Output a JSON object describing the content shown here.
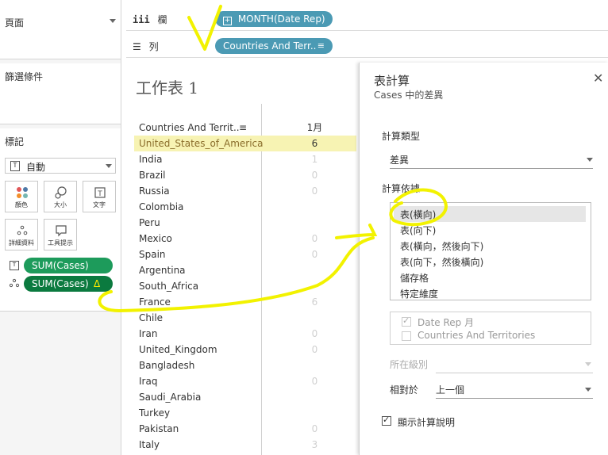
{
  "left_panel": {
    "pages_title": "頁面",
    "filters_title": "篩選條件",
    "marks_title": "標記",
    "mark_type": "自動",
    "mark_buttons": [
      {
        "label": "顏色",
        "icon": "color-dots-icon"
      },
      {
        "label": "大小",
        "icon": "size-icon"
      },
      {
        "label": "文字",
        "icon": "text-icon"
      },
      {
        "label": "詳細資料",
        "icon": "detail-dots-icon"
      },
      {
        "label": "工具提示",
        "icon": "tooltip-icon"
      }
    ],
    "mark_pills": [
      "SUM(Cases)",
      "SUM(Cases)"
    ],
    "delta_symbol": "Δ"
  },
  "shelves": {
    "columns_label": "欄",
    "rows_label": "列",
    "columns_pill": "MONTH(Date Rep)",
    "rows_pill": "Countries And Terr..",
    "plus_symbol": "+"
  },
  "worksheet": {
    "title": "工作表 1",
    "header_country": "Countries And Territ..",
    "header_month": "1月",
    "rows": [
      {
        "name": "United_States_of_America",
        "value": "6"
      },
      {
        "name": "India",
        "value": "1"
      },
      {
        "name": "Brazil",
        "value": "0"
      },
      {
        "name": "Russia",
        "value": "0"
      },
      {
        "name": "Colombia",
        "value": ""
      },
      {
        "name": "Peru",
        "value": ""
      },
      {
        "name": "Mexico",
        "value": "0"
      },
      {
        "name": "Spain",
        "value": "0"
      },
      {
        "name": "Argentina",
        "value": ""
      },
      {
        "name": "South_Africa",
        "value": ""
      },
      {
        "name": "France",
        "value": "6"
      },
      {
        "name": "Chile",
        "value": ""
      },
      {
        "name": "Iran",
        "value": "0"
      },
      {
        "name": "United_Kingdom",
        "value": "0"
      },
      {
        "name": "Bangladesh",
        "value": ""
      },
      {
        "name": "Iraq",
        "value": "0"
      },
      {
        "name": "Saudi_Arabia",
        "value": ""
      },
      {
        "name": "Turkey",
        "value": ""
      },
      {
        "name": "Pakistan",
        "value": "0"
      },
      {
        "name": "Italy",
        "value": "3"
      }
    ]
  },
  "table_calc": {
    "title": "表計算",
    "subtitle": "Cases 中的差異",
    "calc_type_label": "計算類型",
    "calc_type_value": "差異",
    "compute_using_label": "計算依據",
    "options": [
      "表(橫向)",
      "表(向下)",
      "表(橫向，然後向下)",
      "表(向下，然後橫向)",
      "儲存格",
      "特定維度"
    ],
    "selected_option": "表(橫向)",
    "dimensions": [
      {
        "label": "Date Rep 月",
        "checked": true
      },
      {
        "label": "Countries And Territories",
        "checked": false
      }
    ],
    "level_label": "所在級別",
    "relative_label": "相對於",
    "relative_value": "上一個",
    "show_help_label": "顯示計算說明",
    "show_help_checked": true,
    "close_symbol": "✕",
    "check_symbol": "✓"
  },
  "colors": {
    "highlight_row": "#f7f3b3",
    "pill_blue": "#4b9ab4",
    "pill_green": "#1d9b5b",
    "annotation": "#f2f200"
  }
}
